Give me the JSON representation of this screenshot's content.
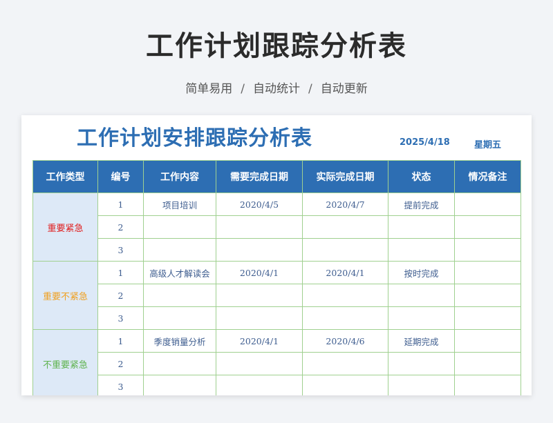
{
  "header": {
    "title": "工作计划跟踪分析表",
    "tags": [
      "简单易用",
      "自动统计",
      "自动更新"
    ],
    "separator": "/"
  },
  "sheet": {
    "title": "工作计划安排跟踪分析表",
    "date": "2025/4/18",
    "weekday": "星期五",
    "columns": [
      "工作类型",
      "编号",
      "工作内容",
      "需要完成日期",
      "实际完成日期",
      "状态",
      "情况备注"
    ],
    "groups": [
      {
        "category": "重要紧急",
        "color": "#e02020",
        "rows": [
          {
            "no": "1",
            "content": "项目培训",
            "due": "2020/4/5",
            "actual": "2020/4/7",
            "status": "提前完成",
            "note": ""
          },
          {
            "no": "2",
            "content": "",
            "due": "",
            "actual": "",
            "status": "",
            "note": ""
          },
          {
            "no": "3",
            "content": "",
            "due": "",
            "actual": "",
            "status": "",
            "note": ""
          }
        ]
      },
      {
        "category": "重要不紧急",
        "color": "#f0a020",
        "rows": [
          {
            "no": "1",
            "content": "高级人才解读会",
            "due": "2020/4/1",
            "actual": "2020/4/1",
            "status": "按时完成",
            "note": ""
          },
          {
            "no": "2",
            "content": "",
            "due": "",
            "actual": "",
            "status": "",
            "note": ""
          },
          {
            "no": "3",
            "content": "",
            "due": "",
            "actual": "",
            "status": "",
            "note": ""
          }
        ]
      },
      {
        "category": "不重要紧急",
        "color": "#5fb34f",
        "rows": [
          {
            "no": "1",
            "content": "季度销量分析",
            "due": "2020/4/1",
            "actual": "2020/4/6",
            "status": "延期完成",
            "note": ""
          },
          {
            "no": "2",
            "content": "",
            "due": "",
            "actual": "",
            "status": "",
            "note": ""
          },
          {
            "no": "3",
            "content": "",
            "due": "",
            "actual": "",
            "status": "",
            "note": ""
          }
        ]
      }
    ]
  }
}
